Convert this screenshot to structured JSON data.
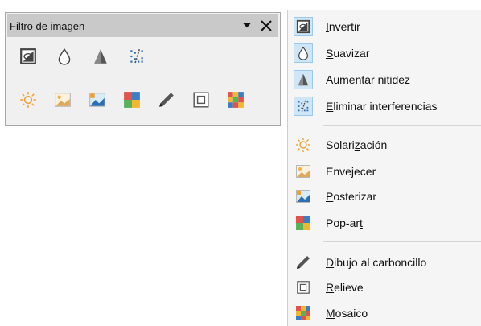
{
  "toolbar": {
    "title": "Filtro de imagen",
    "row1_icons": [
      "invert-icon",
      "smooth-icon",
      "sharpen-icon",
      "remove-noise-icon"
    ],
    "row2_icons": [
      "solarization-icon",
      "aging-icon",
      "posterize-icon",
      "pop-art-icon",
      "charcoal-sketch-icon",
      "relief-icon",
      "mosaic-icon"
    ]
  },
  "menu": {
    "items": [
      {
        "pre": "",
        "u": "I",
        "post": "nvertir",
        "icon": "invert-icon"
      },
      {
        "pre": "",
        "u": "S",
        "post": "uavizar",
        "icon": "smooth-icon"
      },
      {
        "pre": "",
        "u": "A",
        "post": "umentar nitidez",
        "icon": "sharpen-icon"
      },
      {
        "pre": "",
        "u": "E",
        "post": "liminar interferencias",
        "icon": "remove-noise-icon"
      },
      {
        "pre": "Solari",
        "u": "z",
        "post": "ación",
        "icon": "solarization-icon"
      },
      {
        "pre": "Envejecer",
        "u": "",
        "post": "",
        "icon": "aging-icon"
      },
      {
        "pre": "",
        "u": "P",
        "post": "osterizar",
        "icon": "posterize-icon"
      },
      {
        "pre": "Pop-ar",
        "u": "t",
        "post": "",
        "icon": "pop-art-icon"
      },
      {
        "pre": "",
        "u": "D",
        "post": "ibujo al carboncillo",
        "icon": "charcoal-sketch-icon"
      },
      {
        "pre": "",
        "u": "R",
        "post": "elieve",
        "icon": "relief-icon"
      },
      {
        "pre": "",
        "u": "M",
        "post": "osaico",
        "icon": "mosaic-icon"
      }
    ]
  },
  "colors": {
    "titlebar": "#c9c9c9",
    "menu_bg": "#f5f5f5",
    "checked_bg": "#cfe6f7"
  }
}
